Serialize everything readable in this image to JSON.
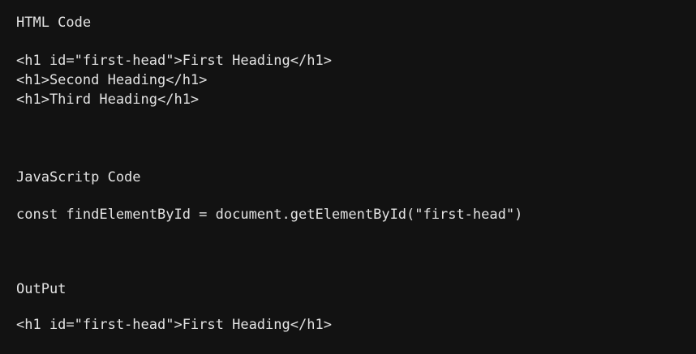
{
  "sections": {
    "html": {
      "title": "HTML Code",
      "lines": [
        "<h1 id=\"first-head\">First Heading</h1>",
        "<h1>Second Heading</h1>",
        "<h1>Third Heading</h1>"
      ]
    },
    "js": {
      "title": "JavaScritp Code",
      "lines": [
        "const findElementById = document.getElementById(\"first-head\")"
      ]
    },
    "output": {
      "title": "OutPut",
      "lines": [
        "<h1 id=\"first-head\">First Heading</h1>"
      ]
    }
  },
  "colors": {
    "background": "#121212",
    "text": "#e3e3e3"
  }
}
